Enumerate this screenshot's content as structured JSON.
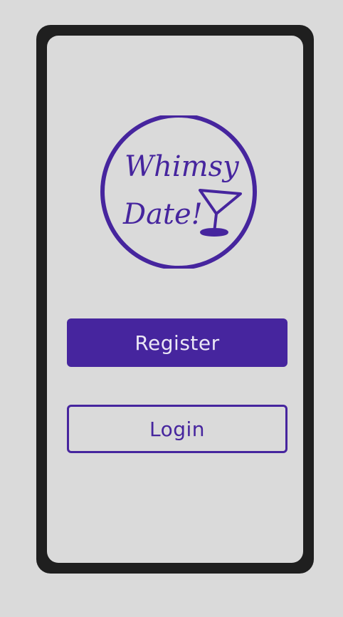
{
  "colors": {
    "page_background": "#dadada",
    "device_frame": "#1f1f1f",
    "screen_background": "#dadada",
    "brand_purple": "#46259e",
    "register_text": "#ebe7f5"
  },
  "logo": {
    "line1": "Whimsy",
    "line2": "Date!",
    "icon": "martini-glass-icon"
  },
  "actions": {
    "register_label": "Register",
    "login_label": "Login"
  }
}
